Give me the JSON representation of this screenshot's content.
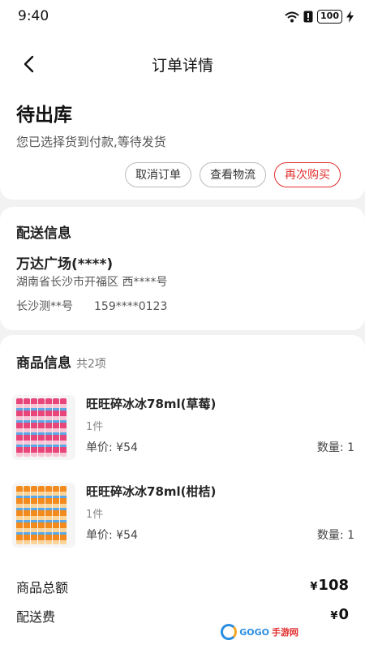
{
  "status_bar": {
    "time": "9:40",
    "battery": "100",
    "icons": [
      "wifi-icon",
      "alert-icon",
      "battery-icon",
      "charging-icon"
    ]
  },
  "nav": {
    "title": "订单详情",
    "back_icon": "back-arrow-icon"
  },
  "order_status": {
    "title": "待出库",
    "subtitle": "您已选择货到付款,等待发货",
    "buttons": {
      "cancel": "取消订单",
      "logistics": "查看物流",
      "rebuy": "再次购买"
    }
  },
  "delivery": {
    "section_title": "配送信息",
    "name": "万达广场(****)",
    "address": "湖南省长沙市开福区 西****号",
    "contact_name": "长沙测**号",
    "phone": "159****0123"
  },
  "goods": {
    "section_title": "商品信息",
    "count_text": "共2项",
    "items": [
      {
        "name": "旺旺碎冰冰78ml(草莓)",
        "qty": "1件",
        "price": "单价: ¥54",
        "amount": "数量: 1",
        "image_color": "pink"
      },
      {
        "name": "旺旺碎冰冰78ml(柑桔)",
        "qty": "1件",
        "price": "单价: ¥54",
        "amount": "数量: 1",
        "image_color": "orange"
      }
    ]
  },
  "summary": {
    "total_label": "商品总额",
    "total_yen": "¥",
    "total_value": "108",
    "shipping_label": "配送费",
    "shipping_yen": "¥",
    "shipping_value": "0"
  },
  "watermark": {
    "brand": "GOGO",
    "suffix": "手游网"
  },
  "colors": {
    "accent": "#e23030",
    "background": "#f2f2f2"
  }
}
